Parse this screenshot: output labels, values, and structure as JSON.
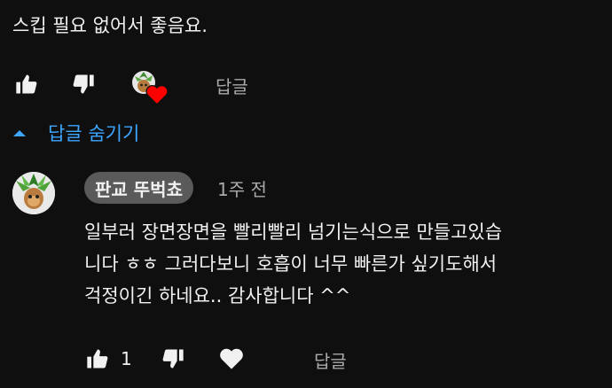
{
  "comment": {
    "text": "스킵 필요 없어서 좋음요.",
    "actions": {
      "like_icon": "thumbs-up-icon",
      "dislike_icon": "thumbs-down-icon",
      "creator_heart": "creator-heart-badge",
      "reply_label": "답글"
    }
  },
  "replies_toggle": {
    "label": "답글 숨기기",
    "icon": "caret-up-icon"
  },
  "reply": {
    "author": "판교 뚜벅쵸",
    "time": "1주 전",
    "lines": [
      "일부러 장면장면을 빨리빨리 넘기는식으로 만들고있습",
      "니다 ㅎㅎ 그러다보니 호흡이 너무 빠른가 싶기도해서",
      "걱정이긴 하네요.. 감사합니다 ^^"
    ],
    "actions": {
      "like_count": "1",
      "like_icon": "thumbs-up-icon",
      "dislike_icon": "thumbs-down-icon",
      "heart_icon": "heart-icon",
      "reply_label": "답글"
    }
  },
  "colors": {
    "background": "#0f0f0f",
    "text": "#f1f1f1",
    "secondary": "#aaaaaa",
    "link": "#3ea6ff",
    "chip": "#5a5a5a",
    "heart": "#ff0000"
  }
}
